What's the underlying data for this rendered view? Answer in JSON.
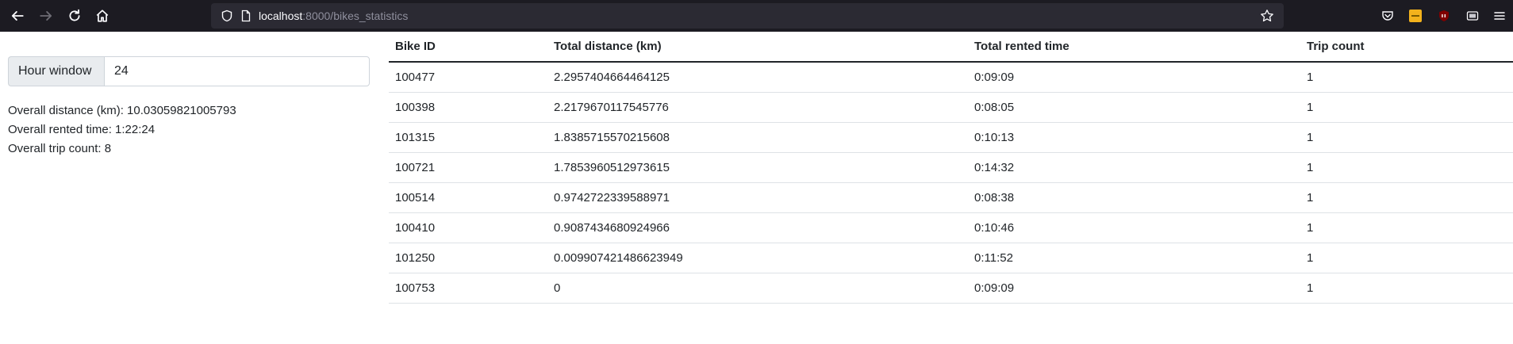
{
  "browser": {
    "url_host": "localhost",
    "url_rest": ":8000/bikes_statistics"
  },
  "form": {
    "hour_window_label": "Hour window",
    "hour_window_value": "24"
  },
  "summary": {
    "overall_distance": "Overall distance (km): 10.03059821005793",
    "overall_rented_time": "Overall rented time: 1:22:24",
    "overall_trip_count": "Overall trip count: 8"
  },
  "table": {
    "headers": [
      "Bike ID",
      "Total distance (km)",
      "Total rented time",
      "Trip count"
    ],
    "rows": [
      [
        "100477",
        "2.2957404664464125",
        "0:09:09",
        "1"
      ],
      [
        "100398",
        "2.2179670117545776",
        "0:08:05",
        "1"
      ],
      [
        "101315",
        "1.8385715570215608",
        "0:10:13",
        "1"
      ],
      [
        "100721",
        "1.7853960512973615",
        "0:14:32",
        "1"
      ],
      [
        "100514",
        "0.9742722339588971",
        "0:08:38",
        "1"
      ],
      [
        "100410",
        "0.9087434680924966",
        "0:10:46",
        "1"
      ],
      [
        "101250",
        "0.009907421486623949",
        "0:11:52",
        "1"
      ],
      [
        "100753",
        "0",
        "0:09:09",
        "1"
      ]
    ]
  },
  "icons": {
    "back": "back-arrow-icon",
    "forward": "forward-arrow-icon",
    "reload": "reload-icon",
    "home": "home-icon",
    "shield": "shield-icon",
    "page": "page-icon",
    "bookmark": "star-icon",
    "pocket": "pocket-icon",
    "extension_yellow": "extension-icon",
    "ublock": "ublock-icon",
    "container": "container-icon",
    "menu": "hamburger-menu-icon"
  },
  "colors": {
    "chrome_bg": "#1c1b22",
    "urlbar_bg": "#2b2a33",
    "table_header_border": "#212529",
    "row_border": "#dee2e6",
    "input_addon_bg": "#e9ecef"
  }
}
